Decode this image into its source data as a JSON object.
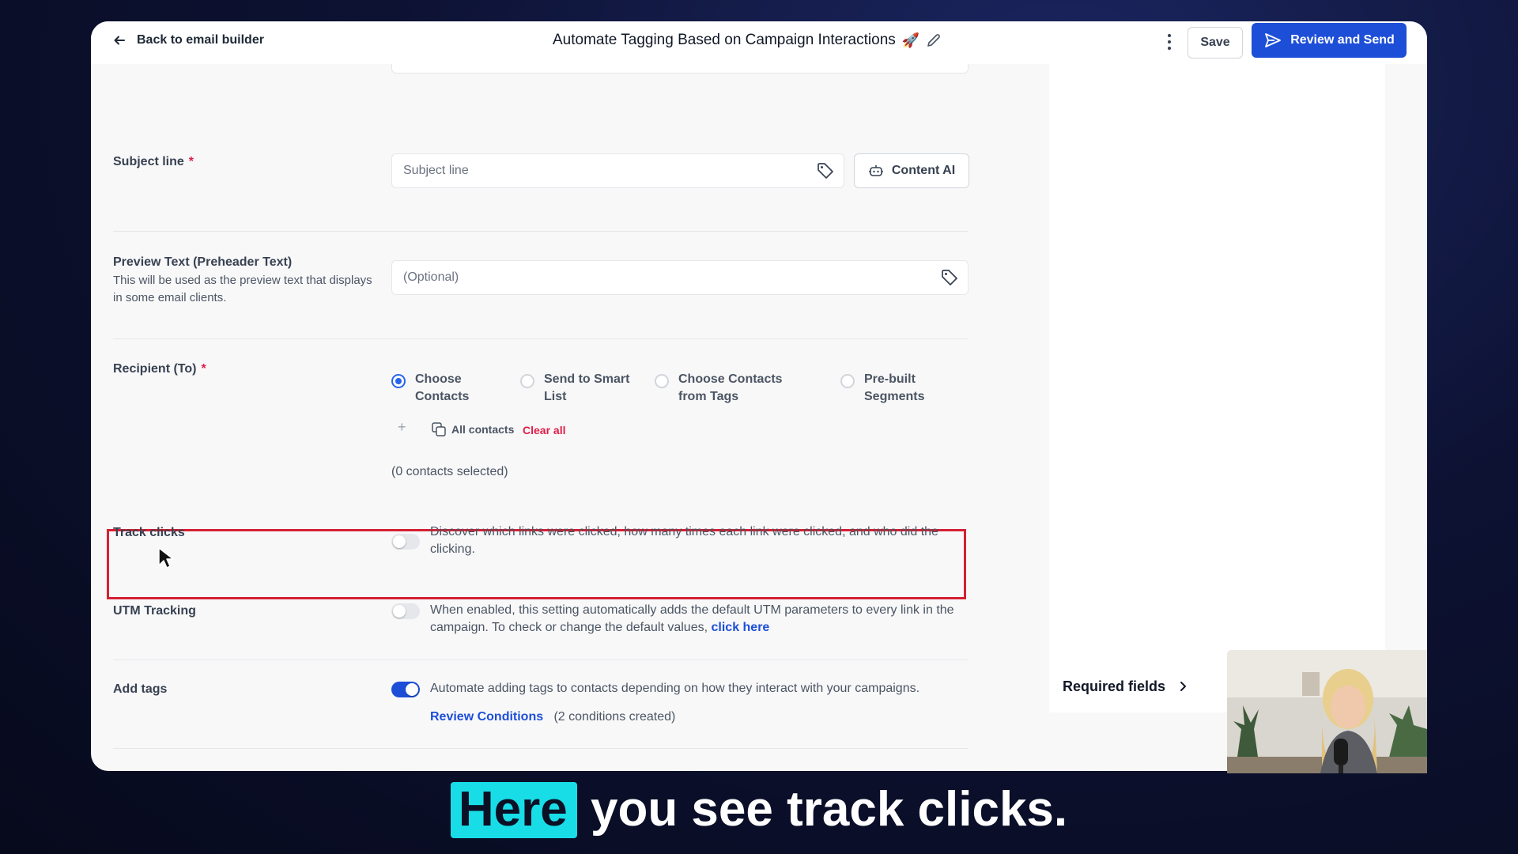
{
  "topbar": {
    "back_label": "Back to email builder",
    "title": "Automate Tagging Based on Campaign Interactions",
    "title_emoji": "🚀",
    "save_label": "Save",
    "review_label": "Review and Send"
  },
  "form": {
    "subject": {
      "label": "Subject line",
      "required_mark": "*",
      "placeholder": "Subject line",
      "content_ai_label": "Content AI"
    },
    "preview": {
      "label": "Preview Text (Preheader Text)",
      "description": "This will be used as the preview text that displays in some email clients.",
      "placeholder": "(Optional)"
    },
    "recipient": {
      "label": "Recipient (To)",
      "required_mark": "*",
      "options": [
        {
          "label": "Choose Contacts",
          "selected": true
        },
        {
          "label": "Send to Smart List",
          "selected": false
        },
        {
          "label": "Choose Contacts from Tags",
          "selected": false
        },
        {
          "label": "Pre-built Segments",
          "selected": false
        }
      ],
      "add_symbol": "+",
      "chip_label": "All contacts",
      "clear_label": "Clear all",
      "count_text": "(0 contacts selected)"
    },
    "track_clicks": {
      "label": "Track clicks",
      "enabled": false,
      "description": "Discover which links were clicked, how many times each link were clicked, and who did the clicking."
    },
    "utm": {
      "label": "UTM Tracking",
      "enabled": false,
      "description": "When enabled, this setting automatically adds the default UTM parameters to every link in the campaign. To check or change the default values,",
      "link_label": "click here"
    },
    "add_tags": {
      "label": "Add tags",
      "enabled": true,
      "description": "Automate adding tags to contacts depending on how they interact with your campaigns.",
      "review_link": "Review Conditions",
      "conditions_text": "(2 conditions created)"
    }
  },
  "sidebar": {
    "required_fields_label": "Required fields"
  },
  "caption": {
    "highlight": "Here",
    "rest": "you see track clicks."
  },
  "colors": {
    "primary": "#1d4ed8",
    "required": "#e11d48",
    "highlight_box": "#d62033",
    "caption_highlight": "#18dde7"
  }
}
